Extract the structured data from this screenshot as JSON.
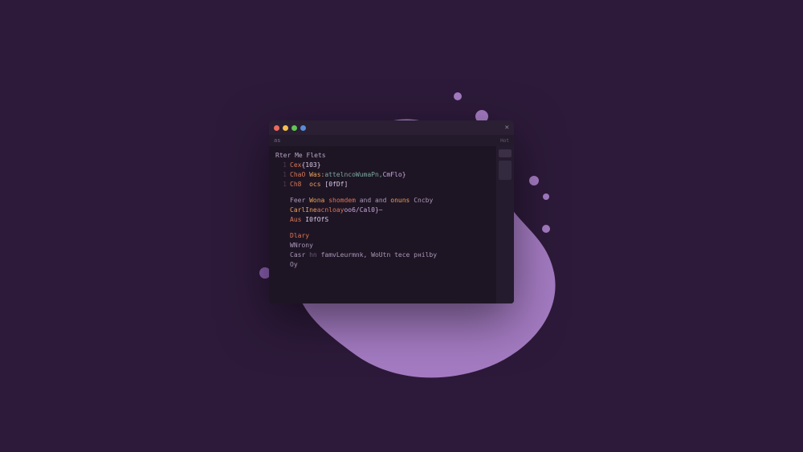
{
  "tab": {
    "left_label": "as",
    "right_label": "Hot"
  },
  "code": {
    "title": "Rter Me Flets",
    "line1_gutter": "1",
    "line1_kw": "Cex",
    "line1_rest": "{103}",
    "line2_gutter": "1",
    "line2_a": "ChaO",
    "line2_b": "Was:",
    "line2_c": "attelncoWumaPn,",
    "line2_d": "CmFlo}",
    "line3_gutter": "1",
    "line3_a": "Ch8",
    "line3_b": "ocs",
    "line3_c": "[0fDf]",
    "line4_a": "Feer",
    "line4_b": "Wona",
    "line4_c": "shomdem",
    "line4_d": "and and",
    "line4_e": "onuns",
    "line4_f": "Cncby",
    "line5_a": "CarlIne",
    "line5_b": "acnloay",
    "line5_c": "oo6/Cal0}~",
    "line6_a": "Aus",
    "line6_b": "I0fOfS",
    "line7_a": "Dlary",
    "line8_a": "WNrony",
    "line9_a": "Casr",
    "line9_b": "hn",
    "line9_c": "famvLeurmnk, WoUtn tece pнilby",
    "line10_a": "Oy"
  }
}
